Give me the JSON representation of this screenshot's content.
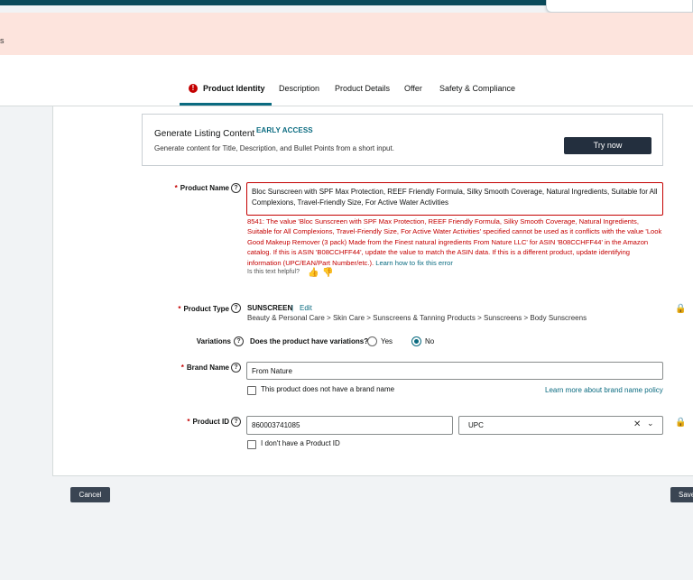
{
  "banner": {
    "text": "s"
  },
  "tabs": [
    {
      "label": "Product Identity"
    },
    {
      "label": "Description"
    },
    {
      "label": "Product Details"
    },
    {
      "label": "Offer"
    },
    {
      "label": "Safety & Compliance"
    }
  ],
  "generate": {
    "title": "Generate Listing Content",
    "badge": "EARLY ACCESS",
    "subtitle": "Generate content for Title, Description, and Bullet Points from a short input.",
    "button": "Try now"
  },
  "product_name": {
    "label": "Product Name",
    "value": "Bloc Sunscreen with SPF Max Protection, REEF Friendly Formula, Silky Smooth Coverage, Natural Ingredients, Suitable for All Complexions, Travel-Friendly Size, For Active Water Activities",
    "error": "8541: The value 'Bloc Sunscreen with SPF Max Protection, REEF Friendly Formula, Silky Smooth Coverage, Natural Ingredients, Suitable for All Complexions, Travel-Friendly Size, For Active Water Activities' specified cannot be used as it conflicts with the value 'Look Good Makeup Remover (3 pack) Made from the Finest natural ingredients From Nature LLC' for ASIN 'B08CCHFF44' in the Amazon catalog. If this is ASIN 'B08CCHFF44', update the value to match the ASIN data. If this is a different product, update identifying information (UPC/EAN/Part Number/etc.).",
    "error_link": "Learn how to fix this error",
    "helpful_text": "Is this text helpful?"
  },
  "product_type": {
    "label": "Product Type",
    "value": "SUNSCREEN",
    "separator": "|",
    "edit_label": "Edit",
    "path": "Beauty & Personal Care > Skin Care > Sunscreens & Tanning Products > Sunscreens > Body Sunscreens"
  },
  "variations": {
    "label": "Variations",
    "question": "Does the product have variations?",
    "yes_label": "Yes",
    "no_label": "No",
    "selected": "No"
  },
  "brand": {
    "label": "Brand Name",
    "value": "From Nature",
    "no_brand_label": "This product does not have a brand name",
    "policy_link": "Learn more about brand name policy"
  },
  "product_id": {
    "label": "Product ID",
    "value": "860003741085",
    "id_type": "UPC",
    "no_id_label": "I don't have a Product ID"
  },
  "footer": {
    "cancel_label": "Cancel",
    "save_label": "Save"
  },
  "colors": {
    "accent": "#0a6b80",
    "error": "#c40000",
    "banner_bg": "#fde4dd",
    "dark_button": "#232f3e"
  }
}
